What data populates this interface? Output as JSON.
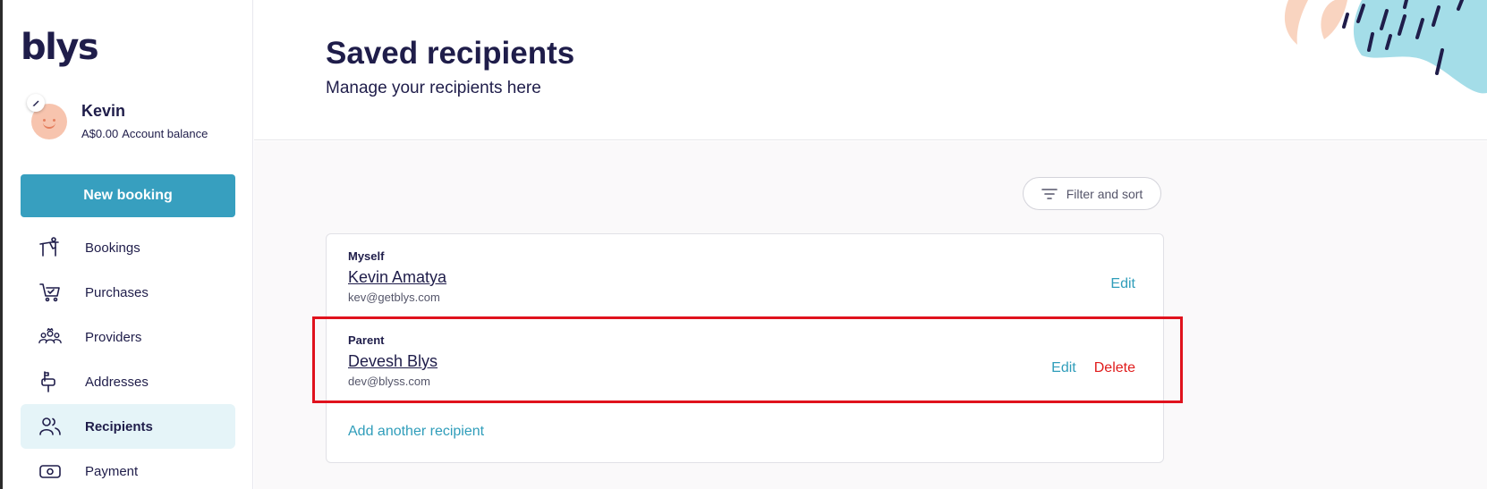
{
  "brand": {
    "logo_text": "blys"
  },
  "user": {
    "name": "Kevin",
    "balance": "A$0.00",
    "balance_label": "Account balance"
  },
  "sidebar": {
    "new_booking_label": "New booking",
    "items": [
      {
        "label": "Bookings",
        "icon": "massage-table-icon",
        "active": false
      },
      {
        "label": "Purchases",
        "icon": "cart-icon",
        "active": false
      },
      {
        "label": "Providers",
        "icon": "providers-group-icon",
        "active": false
      },
      {
        "label": "Addresses",
        "icon": "mailbox-icon",
        "active": false
      },
      {
        "label": "Recipients",
        "icon": "users-icon",
        "active": true
      },
      {
        "label": "Payment",
        "icon": "cash-icon",
        "active": false
      }
    ]
  },
  "page": {
    "title": "Saved recipients",
    "subtitle": "Manage your recipients here"
  },
  "filter": {
    "label": "Filter and sort"
  },
  "recipients": [
    {
      "relationship": "Myself",
      "name": "Kevin Amatya",
      "email": "kev@getblys.com",
      "edit_label": "Edit"
    },
    {
      "relationship": "Parent",
      "name": "Devesh Blys",
      "email": "dev@blyss.com",
      "edit_label": "Edit",
      "delete_label": "Delete"
    }
  ],
  "add_recipient_label": "Add another recipient",
  "colors": {
    "primary": "#379fbf",
    "link": "#2f9dba",
    "danger": "#e01c1c",
    "text": "#1f1d4a",
    "active_nav_bg": "#e5f4f8",
    "highlight": "#e0121d"
  }
}
